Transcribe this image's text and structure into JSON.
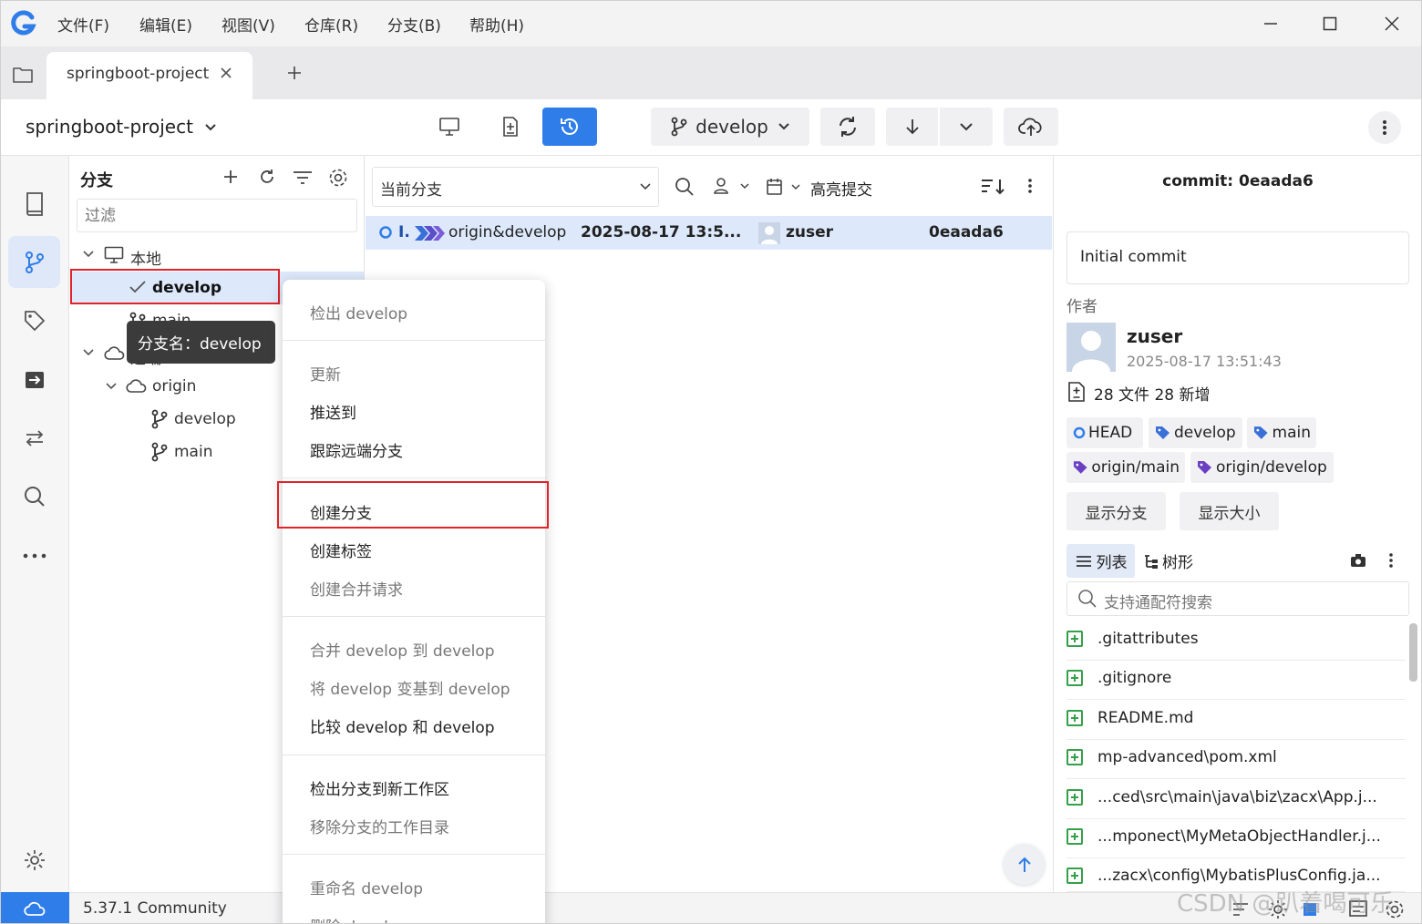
{
  "menu": [
    "文件(F)",
    "编辑(E)",
    "视图(V)",
    "仓库(R)",
    "分支(B)",
    "帮助(H)"
  ],
  "tab": {
    "label": "springboot-project"
  },
  "toolbar": {
    "repo_name": "springboot-project",
    "current_branch": "develop"
  },
  "branch_panel": {
    "title": "分支",
    "filter_placeholder": "过滤",
    "local_label": "本地",
    "local_branches": [
      "develop",
      "main"
    ],
    "remote_label": "远端",
    "remote_name": "origin",
    "remote_branches": [
      "develop",
      "main"
    ],
    "tooltip": "分支名：develop"
  },
  "commit_list": {
    "branch_filter": "当前分支",
    "highlight_label": "高亮提交",
    "rows": [
      {
        "graph_label": "I.",
        "refs": "origin&develop",
        "date": "2025-08-17 13:5...",
        "author": "zuser",
        "hash": "0eaada6"
      }
    ]
  },
  "context_menu": {
    "items": [
      {
        "label": "检出 develop",
        "enabled": false
      },
      {
        "label": "更新",
        "enabled": false
      },
      {
        "label": "推送到",
        "enabled": true
      },
      {
        "label": "跟踪远端分支",
        "enabled": true
      },
      {
        "label": "创建分支",
        "enabled": true
      },
      {
        "label": "创建标签",
        "enabled": true
      },
      {
        "label": "创建合并请求",
        "enabled": false
      },
      {
        "label": "合并 develop 到 develop",
        "enabled": false
      },
      {
        "label": "将 develop 变基到 develop",
        "enabled": false
      },
      {
        "label": "比较 develop 和 develop",
        "enabled": true
      },
      {
        "label": "检出分支到新工作区",
        "enabled": true
      },
      {
        "label": "移除分支的工作目录",
        "enabled": false
      },
      {
        "label": "重命名 develop",
        "enabled": false
      },
      {
        "label": "删除 develop",
        "enabled": false
      }
    ]
  },
  "detail": {
    "header": "commit: 0eaada6",
    "message": "Initial commit",
    "author_label": "作者",
    "author_name": "zuser",
    "author_date": "2025-08-17 13:51:43",
    "file_summary": "28 文件 28 新增",
    "refs": [
      "HEAD",
      "develop",
      "main",
      "origin/main",
      "origin/develop"
    ],
    "show_branches": "显示分支",
    "show_size": "显示大小",
    "view_list": "列表",
    "view_tree": "树形",
    "search_placeholder": "支持通配符搜索",
    "files": [
      ".gitattributes",
      ".gitignore",
      "README.md",
      "mp-advanced\\pom.xml",
      "...ced\\src\\main\\java\\biz\\zacx\\App.j...",
      "...mponect\\MyMetaObjectHandler.j...",
      "...zacx\\config\\MybatisPlusConfig.ja..."
    ]
  },
  "status": {
    "version": "5.37.1 Community",
    "watermark": "CSDN @趴着喝可乐"
  },
  "colors": {
    "accent": "#2e7de9",
    "selection": "#dde9fb",
    "highlight_box": "#e0242b"
  }
}
